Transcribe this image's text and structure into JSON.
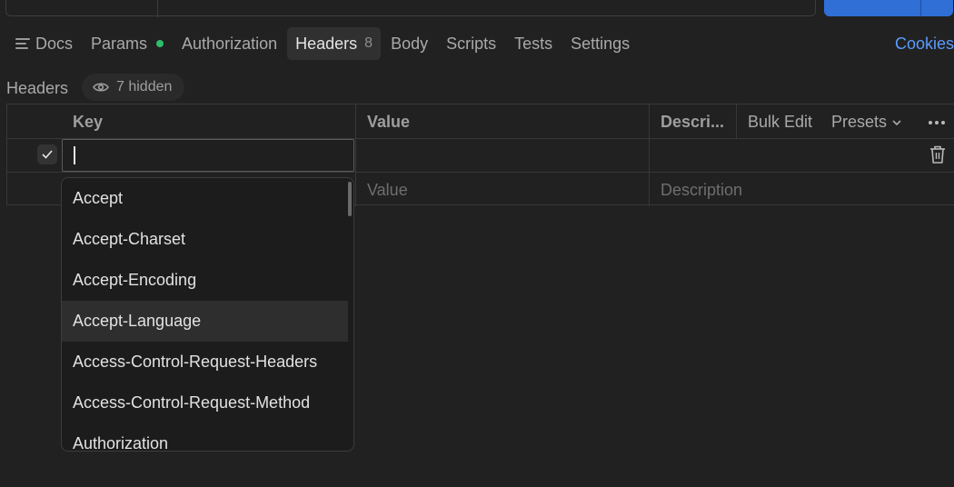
{
  "tabs": [
    {
      "label": "Docs"
    },
    {
      "label": "Params"
    },
    {
      "label": "Authorization"
    },
    {
      "label": "Headers",
      "count": "8"
    },
    {
      "label": "Body"
    },
    {
      "label": "Scripts"
    },
    {
      "label": "Tests"
    },
    {
      "label": "Settings"
    }
  ],
  "cookies_label": "Cookies",
  "headers_section": {
    "label": "Headers",
    "hidden_count": "7 hidden"
  },
  "table": {
    "columns": {
      "key": "Key",
      "value": "Value",
      "description": "Descri..."
    },
    "bulk_edit": "Bulk Edit",
    "presets": "Presets",
    "rows": [
      {
        "checked": true,
        "key": "",
        "value": "",
        "description": ""
      }
    ],
    "new_row": {
      "value_placeholder": "Value",
      "description_placeholder": "Description"
    }
  },
  "autocomplete": {
    "highlighted_index": 3,
    "items": [
      "Accept",
      "Accept-Charset",
      "Accept-Encoding",
      "Accept-Language",
      "Access-Control-Request-Headers",
      "Access-Control-Request-Method",
      "Authorization"
    ]
  },
  "colors": {
    "background": "#212121",
    "accent_blue": "#2f6fd6",
    "link_blue": "#5b9bff",
    "params_dot_green": "#2ebd6b"
  }
}
